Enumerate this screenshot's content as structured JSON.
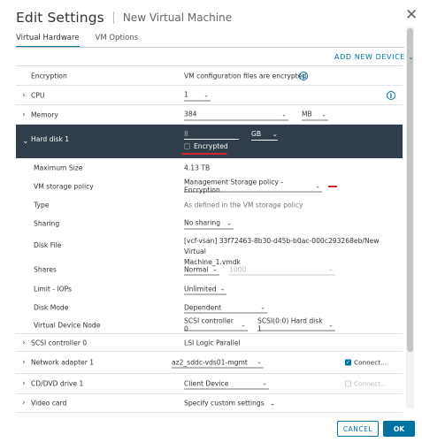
{
  "dialog": {
    "title": "Edit Settings",
    "subtitle": "New Virtual Machine",
    "close_glyph": "✕",
    "tabs": [
      "Virtual Hardware",
      "VM Options"
    ],
    "active_tab": "Virtual Hardware",
    "add_device_label": "ADD NEW DEVICE",
    "add_device_chevron": "⌄"
  },
  "rows": {
    "encryption": {
      "label": "Encryption",
      "value": "VM configuration files are encrypted."
    },
    "cpu": {
      "label": "CPU",
      "value": "1"
    },
    "memory": {
      "label": "Memory",
      "value": "384",
      "unit": "MB"
    },
    "hard_disk": {
      "label": "Hard disk 1",
      "size_value": "8",
      "unit": "GB",
      "encrypted_label": "Encrypted"
    },
    "max_size": {
      "label": "Maximum Size",
      "value": "4.13 TB"
    },
    "storage_policy": {
      "label": "VM storage policy",
      "value": "Management Storage policy - Encryption"
    },
    "type": {
      "label": "Type",
      "value": "As defined in the VM storage policy"
    },
    "sharing": {
      "label": "Sharing",
      "value": "No sharing"
    },
    "disk_file": {
      "label": "Disk File",
      "value_line1": "[vcf-vsan] 33f72463-8b30-d45b-b0ac-000c293268eb/New Virtual",
      "value_line2": "Machine_1.vmdk"
    },
    "shares": {
      "label": "Shares",
      "value": "Normal",
      "amount": "1000"
    },
    "limit_iops": {
      "label": "Limit - IOPs",
      "value": "Unlimited"
    },
    "disk_mode": {
      "label": "Disk Mode",
      "value": "Dependent"
    },
    "vdn": {
      "label": "Virtual Device Node",
      "controller": "SCSI controller 0",
      "node": "SCSI(0:0) Hard disk 1"
    },
    "scsi": {
      "label": "SCSI controller 0",
      "value": "LSI Logic Parallel"
    },
    "network": {
      "label": "Network adapter 1",
      "value": "az2_sddc-vds01-mgmt",
      "connect_label": "Connect..."
    },
    "cdvd": {
      "label": "CD/DVD drive 1",
      "value": "Client Device",
      "connect_label": "Connect..."
    },
    "video": {
      "label": "Video card",
      "value": "Specify custom settings"
    }
  },
  "footer": {
    "cancel_label": "CANCEL",
    "ok_label": "OK"
  },
  "icons": {
    "caret_right": "›",
    "caret_down": "⌄",
    "chevron": "⌄",
    "info": "i",
    "check": "✓"
  },
  "colors": {
    "accent": "#0072a3",
    "selected_row_bg": "#2f3e4a",
    "annotation_red": "#d3262e"
  }
}
